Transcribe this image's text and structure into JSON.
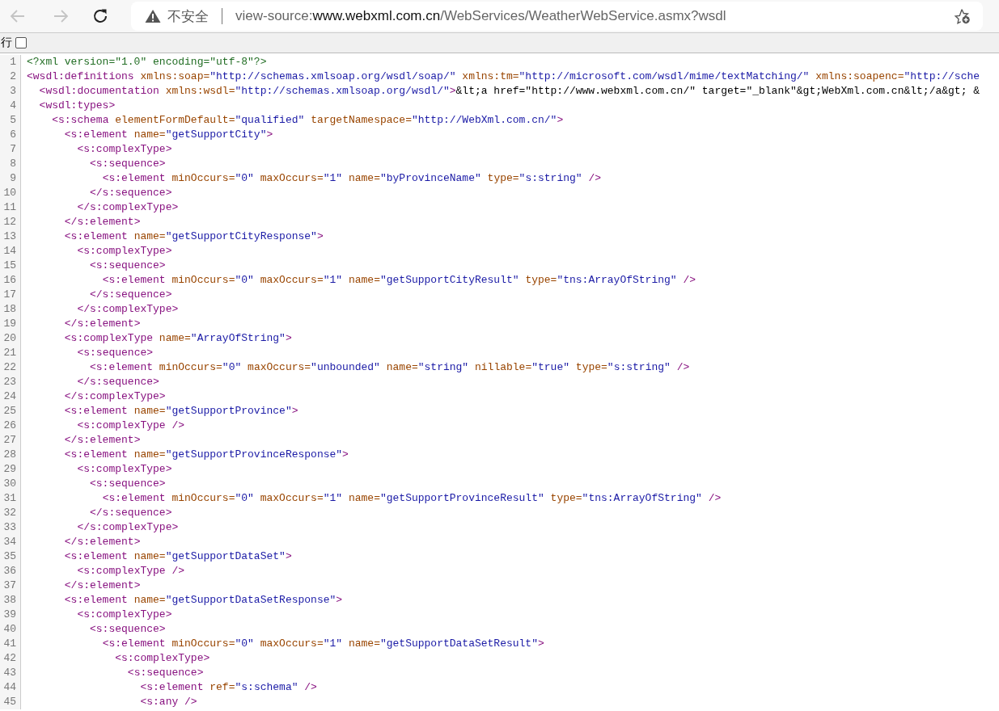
{
  "toolbar": {
    "back": {
      "disabled": true
    },
    "forward": {
      "disabled": true
    },
    "address": {
      "security_label": "不安全",
      "scheme": "view-source:",
      "host": "www.webxml.com.cn",
      "path": "/WebServices/WeatherWebService.asmx?wsdl"
    }
  },
  "line_wrap": {
    "label": "行",
    "checked": false
  },
  "source_lines": [
    {
      "number": "1",
      "text": "<?xml version=\"1.0\" encoding=\"utf-8\"?>"
    },
    {
      "number": "2",
      "text": "<wsdl:definitions xmlns:soap=\"http://schemas.xmlsoap.org/wsdl/soap/\" xmlns:tm=\"http://microsoft.com/wsdl/mime/textMatching/\" xmlns:soapenc=\"http://sche"
    },
    {
      "number": "3",
      "text": "  <wsdl:documentation xmlns:wsdl=\"http://schemas.xmlsoap.org/wsdl/\">&lt;a href=\"http://www.webxml.com.cn/\" target=\"_blank\"&gt;WebXml.com.cn&lt;/a&gt; &"
    },
    {
      "number": "4",
      "text": "  <wsdl:types>"
    },
    {
      "number": "5",
      "text": "    <s:schema elementFormDefault=\"qualified\" targetNamespace=\"http://WebXml.com.cn/\">"
    },
    {
      "number": "6",
      "text": "      <s:element name=\"getSupportCity\">"
    },
    {
      "number": "7",
      "text": "        <s:complexType>"
    },
    {
      "number": "8",
      "text": "          <s:sequence>"
    },
    {
      "number": "9",
      "text": "            <s:element minOccurs=\"0\" maxOccurs=\"1\" name=\"byProvinceName\" type=\"s:string\" />"
    },
    {
      "number": "10",
      "text": "          </s:sequence>"
    },
    {
      "number": "11",
      "text": "        </s:complexType>"
    },
    {
      "number": "12",
      "text": "      </s:element>"
    },
    {
      "number": "13",
      "text": "      <s:element name=\"getSupportCityResponse\">"
    },
    {
      "number": "14",
      "text": "        <s:complexType>"
    },
    {
      "number": "15",
      "text": "          <s:sequence>"
    },
    {
      "number": "16",
      "text": "            <s:element minOccurs=\"0\" maxOccurs=\"1\" name=\"getSupportCityResult\" type=\"tns:ArrayOfString\" />"
    },
    {
      "number": "17",
      "text": "          </s:sequence>"
    },
    {
      "number": "18",
      "text": "        </s:complexType>"
    },
    {
      "number": "19",
      "text": "      </s:element>"
    },
    {
      "number": "20",
      "text": "      <s:complexType name=\"ArrayOfString\">"
    },
    {
      "number": "21",
      "text": "        <s:sequence>"
    },
    {
      "number": "22",
      "text": "          <s:element minOccurs=\"0\" maxOccurs=\"unbounded\" name=\"string\" nillable=\"true\" type=\"s:string\" />"
    },
    {
      "number": "23",
      "text": "        </s:sequence>"
    },
    {
      "number": "24",
      "text": "      </s:complexType>"
    },
    {
      "number": "25",
      "text": "      <s:element name=\"getSupportProvince\">"
    },
    {
      "number": "26",
      "text": "        <s:complexType />"
    },
    {
      "number": "27",
      "text": "      </s:element>"
    },
    {
      "number": "28",
      "text": "      <s:element name=\"getSupportProvinceResponse\">"
    },
    {
      "number": "29",
      "text": "        <s:complexType>"
    },
    {
      "number": "30",
      "text": "          <s:sequence>"
    },
    {
      "number": "31",
      "text": "            <s:element minOccurs=\"0\" maxOccurs=\"1\" name=\"getSupportProvinceResult\" type=\"tns:ArrayOfString\" />"
    },
    {
      "number": "32",
      "text": "          </s:sequence>"
    },
    {
      "number": "33",
      "text": "        </s:complexType>"
    },
    {
      "number": "34",
      "text": "      </s:element>"
    },
    {
      "number": "35",
      "text": "      <s:element name=\"getSupportDataSet\">"
    },
    {
      "number": "36",
      "text": "        <s:complexType />"
    },
    {
      "number": "37",
      "text": "      </s:element>"
    },
    {
      "number": "38",
      "text": "      <s:element name=\"getSupportDataSetResponse\">"
    },
    {
      "number": "39",
      "text": "        <s:complexType>"
    },
    {
      "number": "40",
      "text": "          <s:sequence>"
    },
    {
      "number": "41",
      "text": "            <s:element minOccurs=\"0\" maxOccurs=\"1\" name=\"getSupportDataSetResult\">"
    },
    {
      "number": "42",
      "text": "              <s:complexType>"
    },
    {
      "number": "43",
      "text": "                <s:sequence>"
    },
    {
      "number": "44",
      "text": "                  <s:element ref=\"s:schema\" />"
    },
    {
      "number": "45",
      "text": "                  <s:any />"
    }
  ]
}
